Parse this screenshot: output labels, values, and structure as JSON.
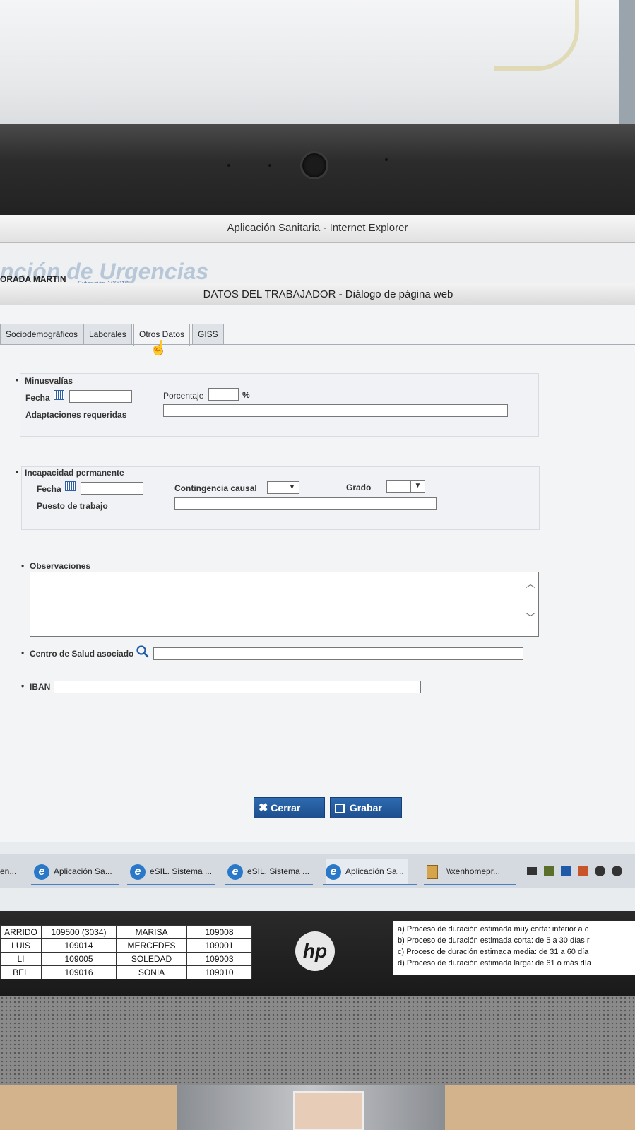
{
  "browser": {
    "window_title": "Aplicación Sanitaria - Internet Explorer",
    "background_app_title": "nción de Urgencias",
    "background_user": "ORADA MARTIN",
    "background_sub": "Extensión 109016"
  },
  "dialog": {
    "title": "DATOS DEL TRABAJADOR - Diálogo de página web",
    "tabs": [
      {
        "label": "Sociodemográficos",
        "active": false
      },
      {
        "label": "Laborales",
        "active": false
      },
      {
        "label": "Otros Datos",
        "active": true
      },
      {
        "label": "GISS",
        "active": false
      }
    ],
    "minusvalias": {
      "heading": "Minusvalías",
      "fecha_label": "Fecha",
      "fecha_value": "",
      "porcentaje_label": "Porcentaje",
      "porcentaje_value": "",
      "percent_sign": "%",
      "adaptaciones_label": "Adaptaciones requeridas",
      "adaptaciones_value": ""
    },
    "incapacidad": {
      "heading": "Incapacidad permanente",
      "fecha_label": "Fecha",
      "fecha_value": "",
      "contingencia_label": "Contingencia causal",
      "contingencia_value": "",
      "grado_label": "Grado",
      "grado_value": "",
      "puesto_label": "Puesto de trabajo",
      "puesto_value": ""
    },
    "observaciones": {
      "heading": "Observaciones",
      "value": ""
    },
    "centro_salud": {
      "label": "Centro de Salud asociado",
      "value": ""
    },
    "iban": {
      "label": "IBAN",
      "value": ""
    },
    "buttons": {
      "cerrar": "Cerrar",
      "grabar": "Grabar"
    }
  },
  "taskbar": {
    "items": [
      {
        "label": "en..."
      },
      {
        "label": "Aplicación Sa..."
      },
      {
        "label": "eSIL. Sistema ..."
      },
      {
        "label": "eSIL. Sistema ..."
      },
      {
        "label": "Aplicación Sa..."
      },
      {
        "label": "\\\\xenhomepr..."
      }
    ]
  },
  "sheet_left": {
    "rows": [
      [
        "ARRIDO",
        "109500 (3034)",
        "MARISA",
        "109008"
      ],
      [
        "LUIS",
        "109014",
        "MERCEDES",
        "109001"
      ],
      [
        "LI",
        "109005",
        "SOLEDAD",
        "109003"
      ],
      [
        "BEL",
        "109016",
        "SONIA",
        "109010"
      ]
    ]
  },
  "brand": {
    "logo_text": "hp"
  },
  "sheet_right": {
    "lines": [
      "a)  Proceso de duración estimada muy corta: inferior a c",
      "b)  Proceso de duración estimada corta: de 5 a 30 días r",
      "c)  Proceso de duración estimada media: de 31 a 60 día",
      "d)  Proceso de duración estimada larga: de 61 o más día"
    ]
  },
  "colors": {
    "button_blue": "#1d4f8e",
    "dialog_bg": "#f2f4f6",
    "title_bar": "#dadada"
  }
}
